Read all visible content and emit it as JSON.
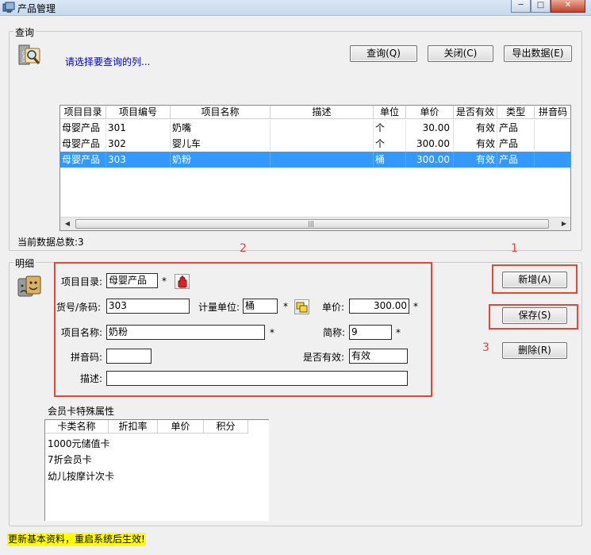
{
  "window": {
    "title": "产品管理"
  },
  "query": {
    "group_label": "查询",
    "hint": "请选择要查询的列...",
    "btn_query": "查询(Q)",
    "btn_close": "关闭(C)",
    "btn_export": "导出数据(E)",
    "icon": "find-icon"
  },
  "table": {
    "columns": [
      "项目目录",
      "项目编号",
      "项目名称",
      "描述",
      "单位",
      "单价",
      "是否有效",
      "类型",
      "拼音码"
    ],
    "rows": [
      [
        "母婴产品",
        "301",
        "奶嘴",
        "",
        "个",
        "30.00",
        "有效",
        "产品",
        ""
      ],
      [
        "母婴产品",
        "302",
        "婴儿车",
        "",
        "个",
        "300.00",
        "有效",
        "产品",
        ""
      ],
      [
        "母婴产品",
        "303",
        "奶粉",
        "",
        "桶",
        "300.00",
        "有效",
        "产品",
        ""
      ]
    ],
    "selected_row": 2,
    "total_label": "当前数据总数:3"
  },
  "detail": {
    "group_label": "明细",
    "icon": "theater-masks-icon",
    "labels": {
      "category": "项目目录:",
      "code": "货号/条码:",
      "unit": "计量单位:",
      "price": "单价:",
      "name": "项目名称:",
      "short": "简称:",
      "pinyin": "拼音码:",
      "valid": "是否有效:",
      "desc": "描述:"
    },
    "values": {
      "category": "母婴产品",
      "code": "303",
      "unit": "桶",
      "price": "300.00",
      "name": "奶粉",
      "short": "9",
      "pinyin": "",
      "valid": "有效",
      "desc": ""
    },
    "required_mark": "*",
    "btn_new": "新增(A)",
    "btn_save": "保存(S)",
    "btn_delete": "删除(R)"
  },
  "annotations": {
    "n1": "1",
    "n2": "2",
    "n3": "3"
  },
  "member_card": {
    "label": "会员卡特殊属性",
    "columns": [
      "卡类名称",
      "折扣率",
      "单价",
      "积分"
    ],
    "rows": [
      "1000元储值卡",
      "7折会员卡",
      "幼儿按摩计次卡"
    ]
  },
  "status_message": "更新基本资料，重启系统后生效!",
  "colors": {
    "selection": "#3399ff",
    "hint": "#0000c0",
    "annotation": "#e8443a",
    "status_bg": "#ffff00"
  }
}
